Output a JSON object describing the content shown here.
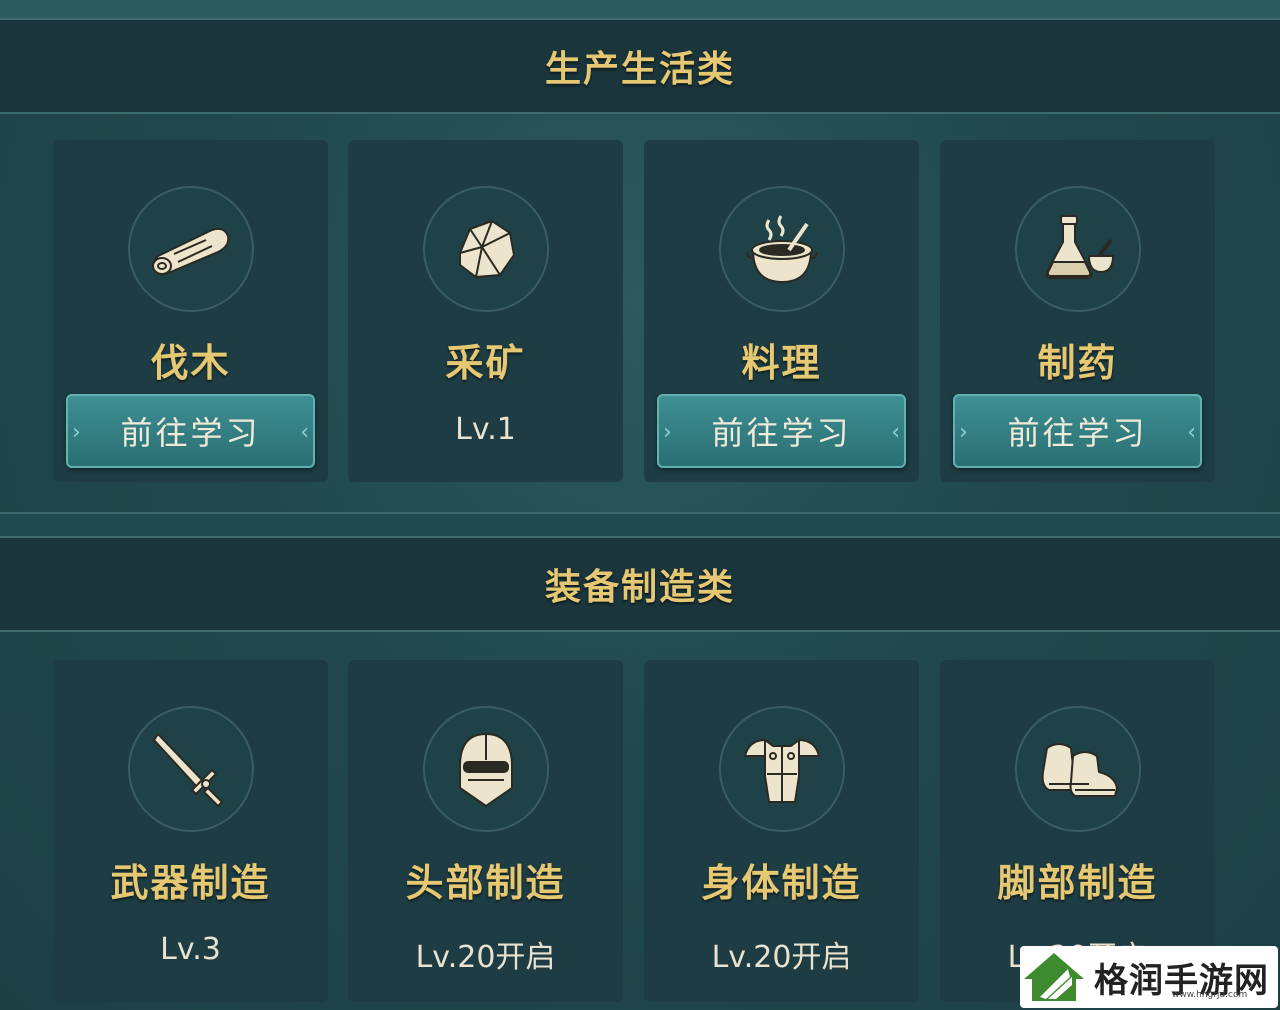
{
  "sections": [
    {
      "title": "生产生活类",
      "cards": [
        {
          "name": "伐木",
          "icon": "log-icon",
          "button": "前往学习"
        },
        {
          "name": "采矿",
          "icon": "ore-icon",
          "level": "Lv.1"
        },
        {
          "name": "料理",
          "icon": "cooking-pot-icon",
          "button": "前往学习"
        },
        {
          "name": "制药",
          "icon": "potion-flask-icon",
          "button": "前往学习"
        }
      ]
    },
    {
      "title": "装备制造类",
      "cards": [
        {
          "name": "武器制造",
          "icon": "sword-icon",
          "level": "Lv.3"
        },
        {
          "name": "头部制造",
          "icon": "helmet-icon",
          "level": "Lv.20开启"
        },
        {
          "name": "身体制造",
          "icon": "armor-icon",
          "level": "Lv.20开启"
        },
        {
          "name": "脚部制造",
          "icon": "boots-icon",
          "level": "Lv.20开启"
        }
      ]
    }
  ],
  "watermark": {
    "text": "格润手游网",
    "url_text": "www.hngrjd.com"
  },
  "colors": {
    "title_gold": "#e6c873",
    "button_teal": "#3e8f93",
    "card_bg": "#1d3c43"
  }
}
